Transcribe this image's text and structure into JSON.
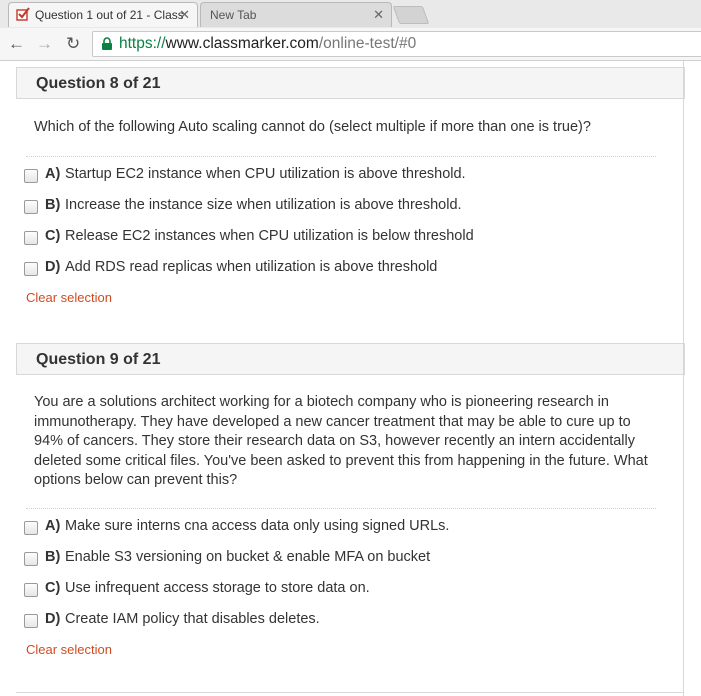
{
  "browser": {
    "tabs": [
      {
        "title": "Question 1 out of 21 - ClassMarker",
        "active": true,
        "favicon": "checkbox-check-icon"
      },
      {
        "title": "New Tab",
        "active": false
      }
    ],
    "url": {
      "scheme": "https://",
      "host": "www.classmarker.com",
      "path": "/online-test/#0"
    }
  },
  "questions": [
    {
      "title": "Question 8 of 21",
      "text": "Which of the following Auto scaling cannot do (select multiple if more than one is true)?",
      "options": [
        {
          "letter": "A)",
          "text": "Startup EC2 instance when CPU utilization is above threshold."
        },
        {
          "letter": "B)",
          "text": "Increase the instance size when utilization is above threshold."
        },
        {
          "letter": "C)",
          "text": "Release EC2 instances when CPU utilization is below threshold"
        },
        {
          "letter": "D)",
          "text": "Add RDS read replicas when utilization is above threshold"
        }
      ],
      "clear_label": "Clear selection"
    },
    {
      "title": "Question 9 of 21",
      "text": "You are a solutions architect working for a biotech company who is pioneering research in immunotherapy. They have developed a new cancer treatment that may be able to cure up to 94% of cancers. They store their research data on S3, however recently an intern accidentally deleted some critical files. You've been asked to prevent this from happening in the future. What options below can prevent this?",
      "options": [
        {
          "letter": "A)",
          "text": "Make sure interns cna access data only using signed URLs."
        },
        {
          "letter": "B)",
          "text": "Enable S3 versioning on bucket & enable MFA on bucket"
        },
        {
          "letter": "C)",
          "text": "Use infrequent access storage to store data on."
        },
        {
          "letter": "D)",
          "text": "Create IAM policy that disables deletes."
        }
      ],
      "clear_label": "Clear selection"
    }
  ],
  "colors": {
    "accent_link": "#d14b22",
    "url_scheme": "#0b8043"
  }
}
